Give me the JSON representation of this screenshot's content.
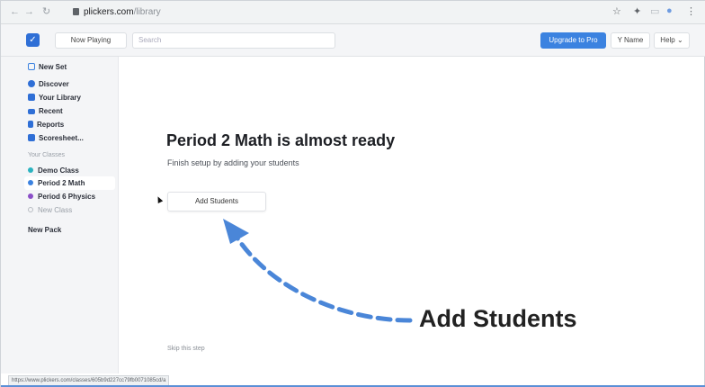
{
  "browser": {
    "back": "←",
    "forward": "→",
    "reload": "↻",
    "url_host": "plickers.com",
    "url_path": "/library",
    "toolbar_icons": [
      "star-icon",
      "extension-icon",
      "profile-icon",
      "menu-icon"
    ]
  },
  "app_bar": {
    "now_playing_label": "Now Playing",
    "search_placeholder": "Search",
    "upgrade_label": "Upgrade to Pro",
    "name_label": "Y Name",
    "help_label": "Help ⌄"
  },
  "sidebar": {
    "items": [
      {
        "label": "New Set",
        "icon": "new-set-icon",
        "color": "#3b82e0"
      },
      {
        "label": "Discover",
        "icon": "discover-icon",
        "color": "#2f6fd6"
      },
      {
        "label": "Your Library",
        "icon": "library-icon",
        "color": "#2f6fd6"
      },
      {
        "label": "Recent",
        "icon": "recent-icon",
        "color": "#2f6fd6"
      },
      {
        "label": "Reports",
        "icon": "reports-icon",
        "color": "#2f6fd6"
      },
      {
        "label": "Scoresheet...",
        "icon": "scoresheet-icon",
        "color": "#2f6fd6"
      }
    ],
    "classes_heading": "Your Classes",
    "classes": [
      {
        "label": "Demo Class",
        "color": "#2bb3c0"
      },
      {
        "label": "Period 2 Math",
        "color": "#3b82e0"
      },
      {
        "label": "Period 6 Physics",
        "color": "#8b4fc7"
      },
      {
        "label": "New Class",
        "color": "#b8bcc2"
      }
    ],
    "new_pack_label": "New Pack"
  },
  "main": {
    "title": "Period 2 Math is almost ready",
    "subtitle": "Finish setup by adding your students",
    "add_students_label": "Add Students",
    "skip_label": "Skip this step"
  },
  "annotation": {
    "label": "Add Students",
    "arrow_color": "#4a86d8"
  },
  "status_bar": {
    "url": "https://www.plickers.com/classes/605b9d227cc79fb0071085cd/a"
  }
}
